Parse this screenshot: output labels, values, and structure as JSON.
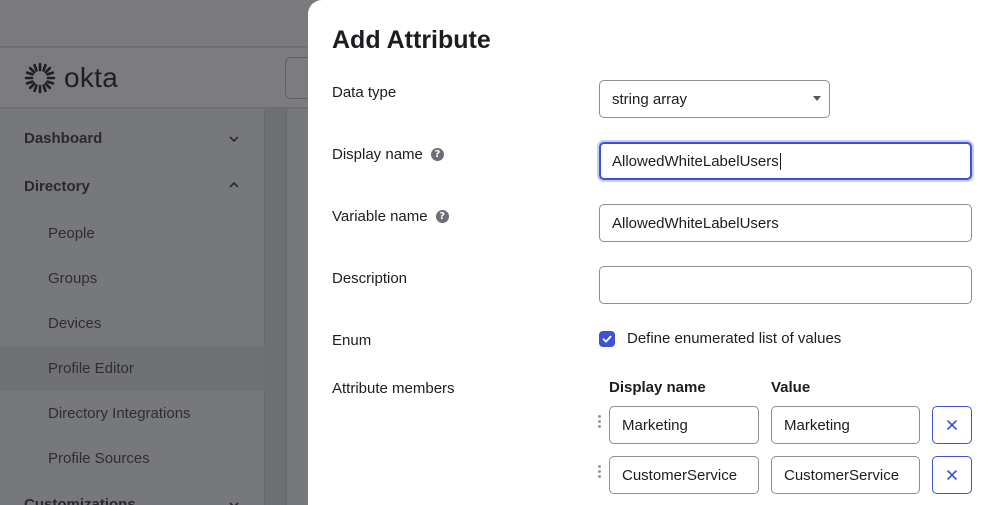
{
  "app": {
    "logo_text": "okta",
    "sidebar": {
      "items": [
        {
          "label": "Dashboard",
          "type": "section",
          "expanded": false
        },
        {
          "label": "Directory",
          "type": "section",
          "expanded": true
        },
        {
          "label": "People",
          "type": "sub"
        },
        {
          "label": "Groups",
          "type": "sub"
        },
        {
          "label": "Devices",
          "type": "sub"
        },
        {
          "label": "Profile Editor",
          "type": "sub",
          "active": true
        },
        {
          "label": "Directory Integrations",
          "type": "sub"
        },
        {
          "label": "Profile Sources",
          "type": "sub"
        },
        {
          "label": "Customizations",
          "type": "section",
          "expanded": false
        }
      ]
    }
  },
  "modal": {
    "title": "Add Attribute",
    "fields": {
      "data_type": {
        "label": "Data type",
        "value": "string array"
      },
      "display_name": {
        "label": "Display name",
        "value": "AllowedWhiteLabelUsers"
      },
      "variable_name": {
        "label": "Variable name",
        "value": "AllowedWhiteLabelUsers"
      },
      "description": {
        "label": "Description",
        "value": ""
      },
      "enum": {
        "label": "Enum",
        "checkbox_label": "Define enumerated list of values",
        "checked": true
      }
    },
    "members": {
      "label": "Attribute members",
      "col_display_name": "Display name",
      "col_value": "Value",
      "rows": [
        {
          "display_name": "Marketing",
          "value": "Marketing"
        },
        {
          "display_name": "CustomerService",
          "value": "CustomerService"
        }
      ]
    }
  },
  "colors": {
    "accent": "#3d52d5",
    "overlay": "#6f7072"
  }
}
